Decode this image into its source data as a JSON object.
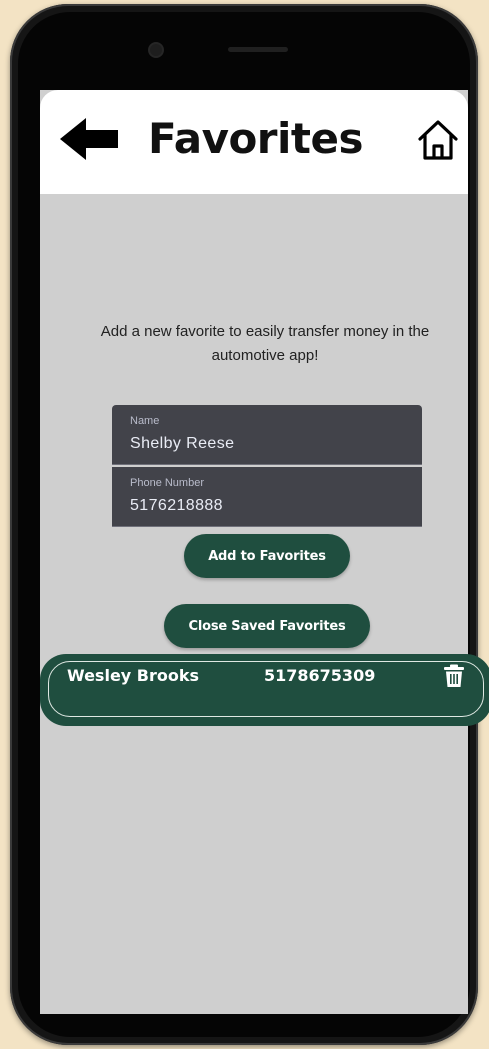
{
  "header": {
    "title": "Favorites",
    "back_icon": "left-arrow-icon",
    "home_icon": "home-icon"
  },
  "intro_text": "Add a new favorite to easily transfer money in the automotive app!",
  "form": {
    "name": {
      "label": "Name",
      "value": "Shelby Reese"
    },
    "phone": {
      "label": "Phone Number",
      "value": "5176218888"
    }
  },
  "buttons": {
    "add_label": "Add to Favorites",
    "close_label": "Close Saved Favorites"
  },
  "favorites": [
    {
      "name": "Wesley Brooks",
      "phone": "5178675309",
      "delete_icon": "trash-icon"
    }
  ],
  "colors": {
    "accent": "#1f4e3f",
    "screen_background": "#cfcfcf",
    "field_background": "#42434a",
    "page_background": "#f3e3c4"
  }
}
